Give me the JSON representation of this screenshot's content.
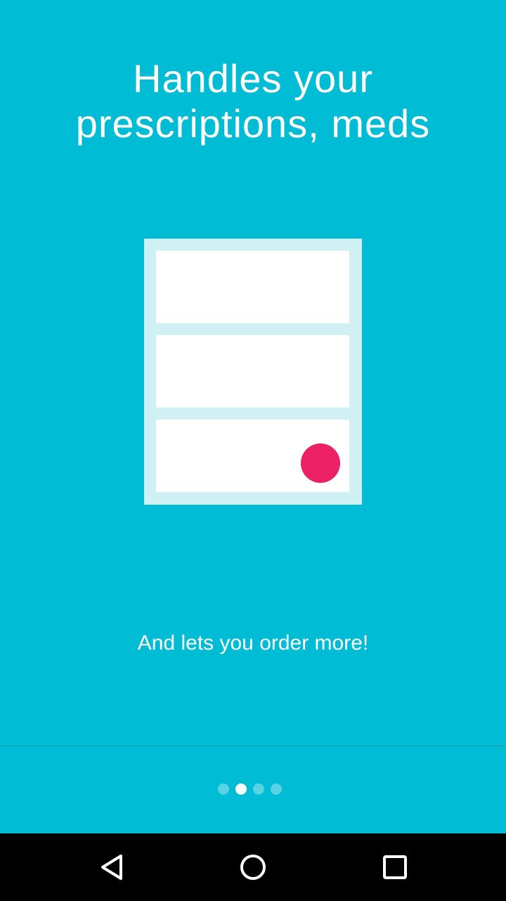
{
  "onboarding": {
    "headline_line1": "Handles your",
    "headline_line2": "prescriptions, meds",
    "subtitle": "And lets you order more!",
    "pager": {
      "page_count": 4,
      "active_index": 1
    }
  },
  "navbar": {
    "back_icon": "back-triangle-icon",
    "home_icon": "home-circle-icon",
    "recents_icon": "recents-square-icon"
  },
  "colors": {
    "background": "#00BCD4",
    "illustration_panel": "#CFF0F4",
    "card": "#FFFFFF",
    "accent_dot": "#EC2064",
    "navbar": "#000000"
  }
}
